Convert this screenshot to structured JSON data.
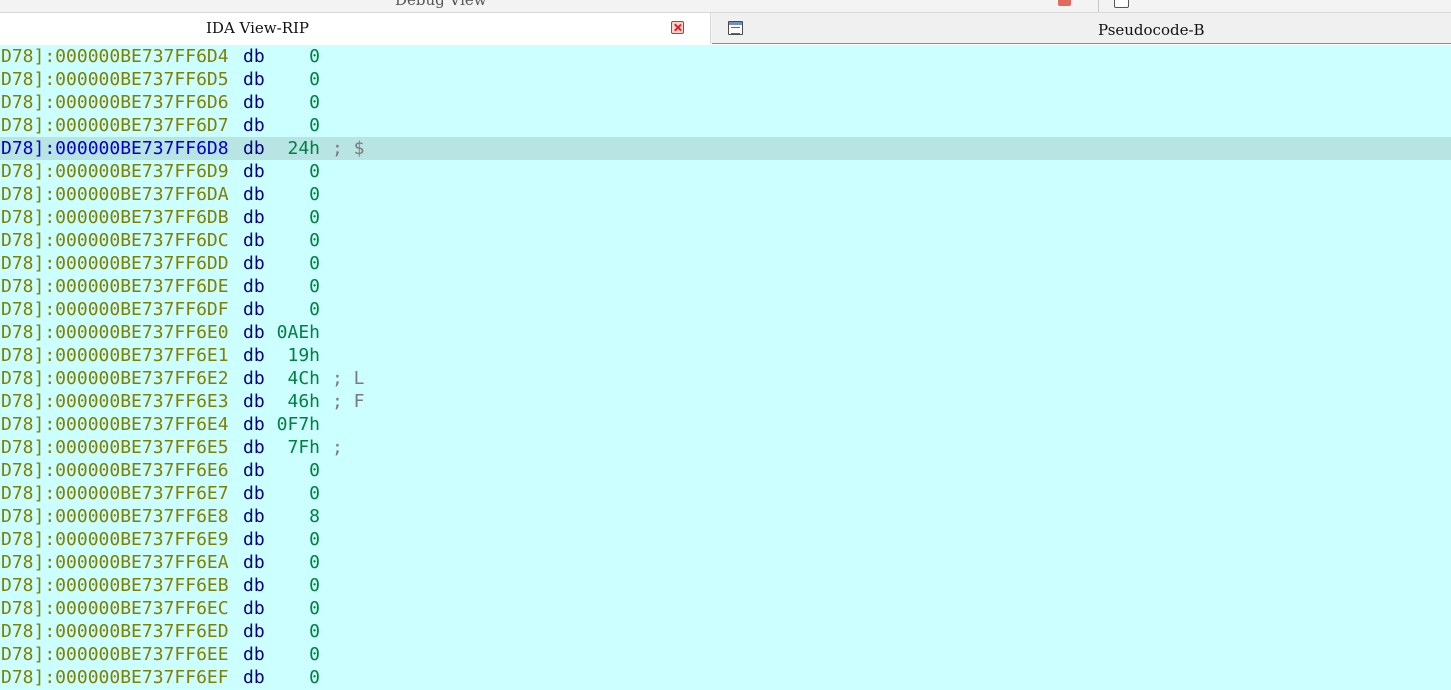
{
  "upper_tabs": {
    "partial_title": "Debug View"
  },
  "tabs": [
    {
      "title": "IDA View-RIP",
      "active": true
    },
    {
      "title": "Pseudocode-B",
      "active": false
    }
  ],
  "listing": {
    "rows": [
      {
        "address": "D78]:000000BE737FF6D4",
        "mnemonic": "db",
        "value": "0",
        "comment": ""
      },
      {
        "address": "D78]:000000BE737FF6D5",
        "mnemonic": "db",
        "value": "0",
        "comment": ""
      },
      {
        "address": "D78]:000000BE737FF6D6",
        "mnemonic": "db",
        "value": "0",
        "comment": ""
      },
      {
        "address": "D78]:000000BE737FF6D7",
        "mnemonic": "db",
        "value": "0",
        "comment": ""
      },
      {
        "address": "D78]:000000BE737FF6D8",
        "mnemonic": "db",
        "value": "24h",
        "comment": "; $",
        "selected": true
      },
      {
        "address": "D78]:000000BE737FF6D9",
        "mnemonic": "db",
        "value": "0",
        "comment": ""
      },
      {
        "address": "D78]:000000BE737FF6DA",
        "mnemonic": "db",
        "value": "0",
        "comment": ""
      },
      {
        "address": "D78]:000000BE737FF6DB",
        "mnemonic": "db",
        "value": "0",
        "comment": ""
      },
      {
        "address": "D78]:000000BE737FF6DC",
        "mnemonic": "db",
        "value": "0",
        "comment": ""
      },
      {
        "address": "D78]:000000BE737FF6DD",
        "mnemonic": "db",
        "value": "0",
        "comment": ""
      },
      {
        "address": "D78]:000000BE737FF6DE",
        "mnemonic": "db",
        "value": "0",
        "comment": ""
      },
      {
        "address": "D78]:000000BE737FF6DF",
        "mnemonic": "db",
        "value": "0",
        "comment": ""
      },
      {
        "address": "D78]:000000BE737FF6E0",
        "mnemonic": "db",
        "value": "0AEh",
        "comment": ""
      },
      {
        "address": "D78]:000000BE737FF6E1",
        "mnemonic": "db",
        "value": "19h",
        "comment": ""
      },
      {
        "address": "D78]:000000BE737FF6E2",
        "mnemonic": "db",
        "value": "4Ch",
        "comment": "; L"
      },
      {
        "address": "D78]:000000BE737FF6E3",
        "mnemonic": "db",
        "value": "46h",
        "comment": "; F"
      },
      {
        "address": "D78]:000000BE737FF6E4",
        "mnemonic": "db",
        "value": "0F7h",
        "comment": ""
      },
      {
        "address": "D78]:000000BE737FF6E5",
        "mnemonic": "db",
        "value": "7Fh",
        "comment": ";"
      },
      {
        "address": "D78]:000000BE737FF6E6",
        "mnemonic": "db",
        "value": "0",
        "comment": ""
      },
      {
        "address": "D78]:000000BE737FF6E7",
        "mnemonic": "db",
        "value": "0",
        "comment": ""
      },
      {
        "address": "D78]:000000BE737FF6E8",
        "mnemonic": "db",
        "value": "8",
        "comment": ""
      },
      {
        "address": "D78]:000000BE737FF6E9",
        "mnemonic": "db",
        "value": "0",
        "comment": ""
      },
      {
        "address": "D78]:000000BE737FF6EA",
        "mnemonic": "db",
        "value": "0",
        "comment": ""
      },
      {
        "address": "D78]:000000BE737FF6EB",
        "mnemonic": "db",
        "value": "0",
        "comment": ""
      },
      {
        "address": "D78]:000000BE737FF6EC",
        "mnemonic": "db",
        "value": "0",
        "comment": ""
      },
      {
        "address": "D78]:000000BE737FF6ED",
        "mnemonic": "db",
        "value": "0",
        "comment": ""
      },
      {
        "address": "D78]:000000BE737FF6EE",
        "mnemonic": "db",
        "value": "0",
        "comment": ""
      },
      {
        "address": "D78]:000000BE737FF6EF",
        "mnemonic": "db",
        "value": "0",
        "comment": ""
      }
    ]
  },
  "colors": {
    "listing_background": "#ccffff",
    "selected_row": "#b8e4e4",
    "address": "#808000",
    "selected_address": "#0000cc",
    "mnemonic": "#000080",
    "value": "#008040",
    "comment": "#7a7a7a"
  },
  "icons": {
    "close_tab": "close-icon",
    "pseudocode_tab": "pseudocode-window-icon"
  }
}
